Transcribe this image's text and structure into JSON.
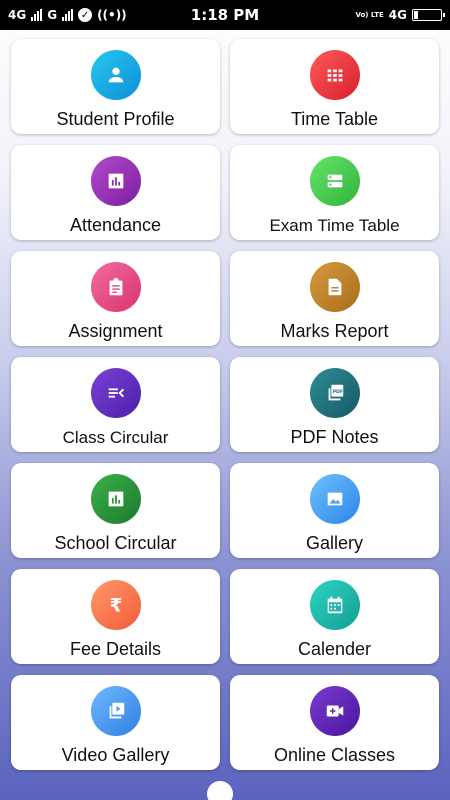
{
  "status_bar": {
    "left_net1": "4G",
    "left_net2": "G",
    "time": "1:18 PM",
    "volte": "Vo) LTE",
    "right_net": "4G"
  },
  "tiles": [
    {
      "label": "Student Profile",
      "icon": "person-icon",
      "color_from": "#29c6f0",
      "color_to": "#0d8fd8"
    },
    {
      "label": "Time Table",
      "icon": "grid-icon",
      "color_from": "#ff5a5a",
      "color_to": "#d61f2c"
    },
    {
      "label": "Attendance",
      "icon": "bar-chart-icon",
      "color_from": "#b24ac9",
      "color_to": "#7a1fa0"
    },
    {
      "label": "Exam Time Table",
      "icon": "storage-icon",
      "color_from": "#66e36b",
      "color_to": "#2fb53a"
    },
    {
      "label": "Assignment",
      "icon": "clipboard-icon",
      "color_from": "#f26b9f",
      "color_to": "#d8346f"
    },
    {
      "label": "Marks Report",
      "icon": "document-icon",
      "color_from": "#d49a40",
      "color_to": "#a96d18"
    },
    {
      "label": "Class Circular",
      "icon": "list-icon",
      "color_from": "#7a42d8",
      "color_to": "#4b1fa8"
    },
    {
      "label": "PDF Notes",
      "icon": "pdf-icon",
      "color_from": "#2f8c94",
      "color_to": "#145a66"
    },
    {
      "label": "School Circular",
      "icon": "bar-chart-icon",
      "color_from": "#3bb04a",
      "color_to": "#1d7a2e"
    },
    {
      "label": "Gallery",
      "icon": "image-icon",
      "color_from": "#6fc0ff",
      "color_to": "#2a86e6"
    },
    {
      "label": "Fee Details",
      "icon": "rupee-icon",
      "color_from": "#ff9a6a",
      "color_to": "#f25b3a"
    },
    {
      "label": "Calender",
      "icon": "calendar-icon",
      "color_from": "#2fd4c3",
      "color_to": "#129e92"
    },
    {
      "label": "Video Gallery",
      "icon": "video-library-icon",
      "color_from": "#6fb8ff",
      "color_to": "#2f7fe0"
    },
    {
      "label": "Online Classes",
      "icon": "video-camera-icon",
      "color_from": "#7b3bd0",
      "color_to": "#4a169e"
    }
  ]
}
